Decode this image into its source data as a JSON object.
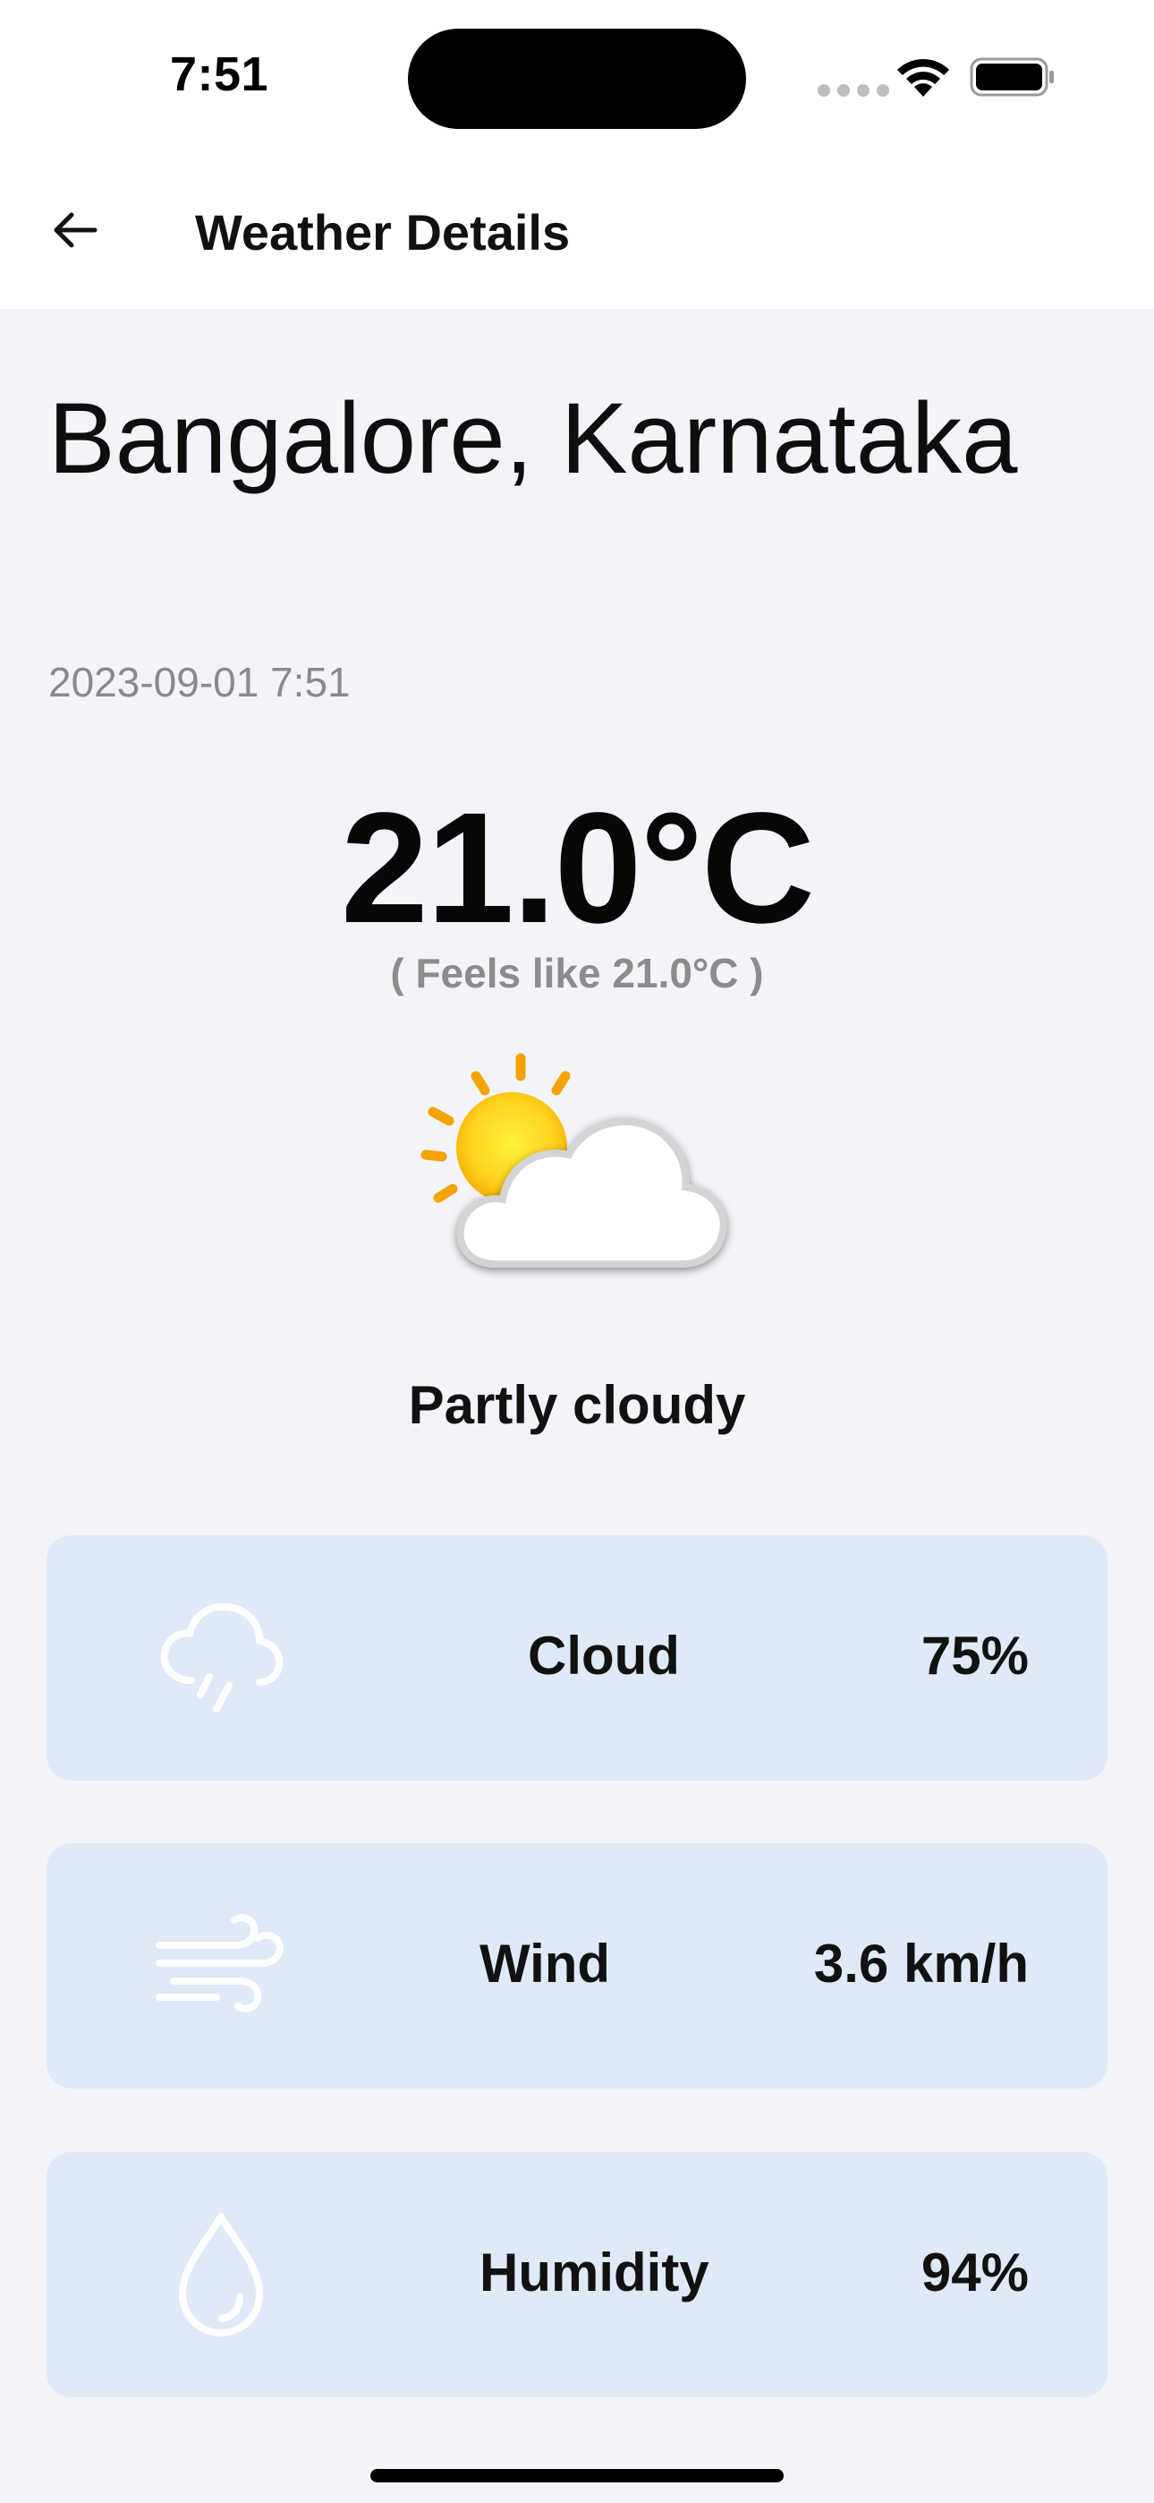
{
  "status_bar": {
    "time": "7:51"
  },
  "app_bar": {
    "title": "Weather Details"
  },
  "weather": {
    "location": "Bangalore, Karnataka",
    "datetime": "2023-09-01 7:51",
    "temperature": "21.0°C",
    "feels_like": "( Feels like 21.0°C )",
    "condition": "Partly cloudy",
    "icon": "partly-cloudy-icon"
  },
  "cards": [
    {
      "icon": "cloud-rain-icon",
      "label": "Cloud",
      "value": "75%"
    },
    {
      "icon": "wind-icon",
      "label": "Wind",
      "value": "3.6 km/h"
    },
    {
      "icon": "droplet-icon",
      "label": "Humidity",
      "value": "94%"
    }
  ],
  "colors": {
    "background": "#F2F4F9",
    "card_background": "#DEEAF8",
    "sun": "#FFD21F",
    "sun_rays": "#F5A300"
  }
}
